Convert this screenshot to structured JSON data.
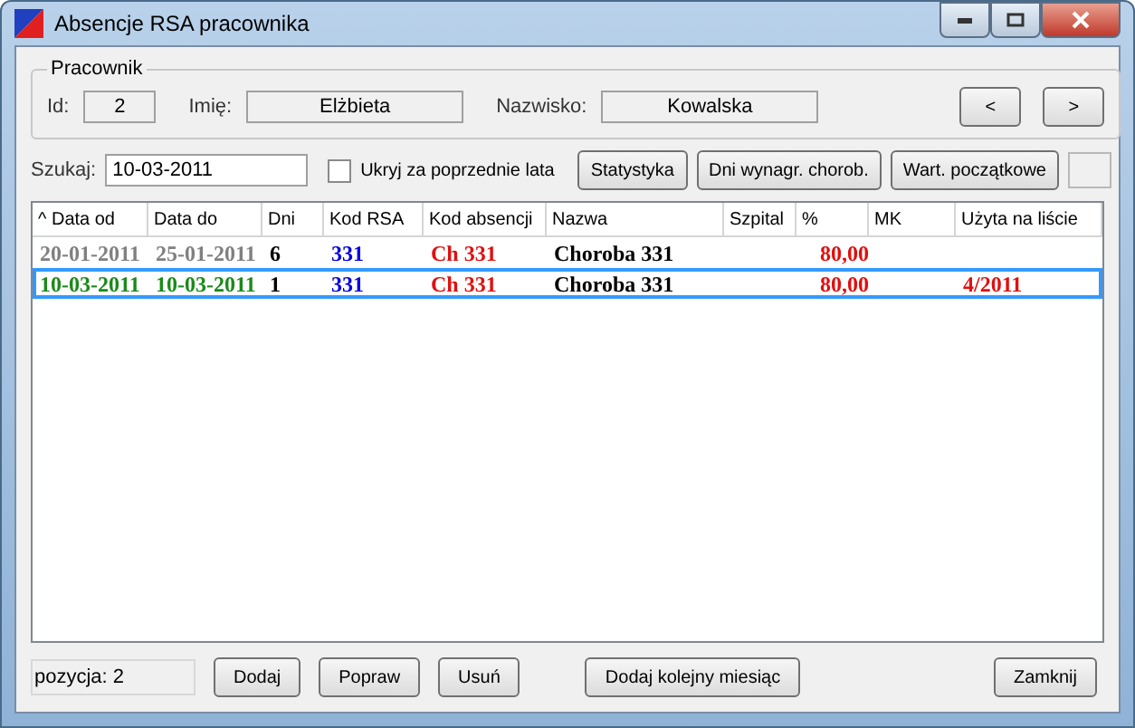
{
  "window": {
    "title": "Absencje RSA pracownika"
  },
  "employee": {
    "legend": "Pracownik",
    "fields": [
      {
        "label": "Id:",
        "value": "2"
      },
      {
        "label": "Imię:",
        "value": "Elżbieta"
      },
      {
        "label": "Nazwisko:",
        "value": "Kowalska"
      }
    ],
    "nav": [
      "<",
      ">"
    ]
  },
  "search": {
    "label": "Szukaj:",
    "value": "10-03-2011"
  },
  "hide_previous": {
    "label": "Ukryj za poprzednie lata",
    "checked": false
  },
  "tools": [
    "Statystyka",
    "Dni wynagr. chorob.",
    "Wart. początkowe"
  ],
  "table": {
    "columns": [
      "^ Data od",
      "Data do",
      "Dni",
      "Kod RSA",
      "Kod absencji",
      "Nazwa",
      "Szpital",
      "%",
      "MK",
      "Użyta na liście"
    ],
    "rows": [
      {
        "selected": false,
        "color": "#808080",
        "cells": [
          "20-01-2011",
          "25-01-2011",
          "6",
          "331",
          "Ch 331",
          "Choroba 331",
          "",
          "80,00",
          "",
          ""
        ]
      },
      {
        "selected": true,
        "color": "#1a8a1a",
        "cells": [
          "10-03-2011",
          "10-03-2011",
          "1",
          "331",
          "Ch 331",
          "Choroba 331",
          "",
          "80,00",
          "",
          "4/2011"
        ]
      }
    ]
  },
  "position": "pozycja:  2",
  "actions": [
    "Dodaj",
    "Popraw",
    "Usuń",
    "Dodaj kolejny miesiąc"
  ],
  "close": "Zamknij"
}
